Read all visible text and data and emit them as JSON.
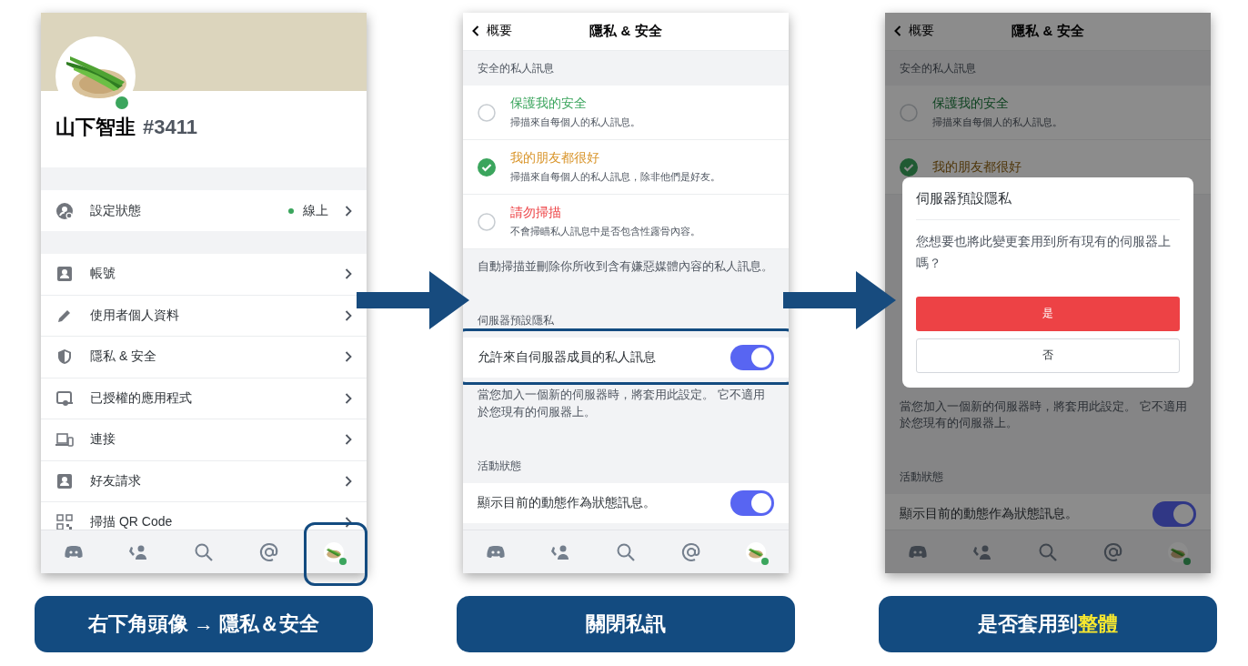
{
  "panels": [
    {
      "kind": "profile",
      "profile": {
        "name": "山下智韭",
        "tag": "#3411"
      },
      "status_row": {
        "label": "設定狀態",
        "value": "線上"
      },
      "menu": [
        {
          "kind": "account",
          "label": "帳號"
        },
        {
          "kind": "pencil",
          "label": "使用者個人資料"
        },
        {
          "kind": "shield",
          "label": "隱私 & 安全"
        },
        {
          "kind": "apps",
          "label": "已授權的應用程式"
        },
        {
          "kind": "devices",
          "label": "連接"
        },
        {
          "kind": "account",
          "label": "好友請求"
        },
        {
          "kind": "qr",
          "label": "掃描 QR Code"
        }
      ],
      "nav": [
        {
          "kind": "home",
          "highlighted": false
        },
        {
          "kind": "friends",
          "highlighted": false
        },
        {
          "kind": "search",
          "highlighted": false
        },
        {
          "kind": "mentions",
          "highlighted": false
        },
        {
          "kind": "profile",
          "highlighted": true
        }
      ],
      "caption": [
        {
          "text": "右下角頭像 → 隱私＆安全",
          "highlight": false
        }
      ]
    },
    {
      "kind": "settings",
      "dimmed": false,
      "header": {
        "back": "概要",
        "title": "隱私 & 安全"
      },
      "blocks": [
        {
          "kind": "label",
          "text": "安全的私人訊息"
        },
        {
          "kind": "radio",
          "title": "保護我的安全",
          "desc": "掃描來自每個人的私人訊息。",
          "color": "#3ba55d",
          "selected": false
        },
        {
          "kind": "radio",
          "title": "我的朋友都很好",
          "desc": "掃描來自每個人的私人訊息，除非他們是好友。",
          "color": "#d9952b",
          "selected": true
        },
        {
          "kind": "radio",
          "title": "請勿掃描",
          "desc": "不會掃瞄私人訊息中是否包含性露骨內容。",
          "color": "#ed4245",
          "selected": false
        },
        {
          "kind": "note",
          "text": "自動掃描並刪除你所收到含有嫌惡媒體內容的私人訊息。"
        },
        {
          "kind": "label",
          "text": "伺服器預設隱私"
        },
        {
          "kind": "toggle",
          "label": "允許來自伺服器成員的私人訊息",
          "on": true,
          "highlighted": true
        },
        {
          "kind": "note",
          "text": "當您加入一個新的伺服器時，將套用此設定。 它不適用於您現有的伺服器上。"
        },
        {
          "kind": "label",
          "text": "活動狀態"
        },
        {
          "kind": "toggle",
          "label": "顯示目前的動態作為狀態訊息。",
          "on": true,
          "highlighted": false
        }
      ],
      "nav": [
        {
          "kind": "home",
          "highlighted": false
        },
        {
          "kind": "friends",
          "highlighted": false
        },
        {
          "kind": "search",
          "highlighted": false
        },
        {
          "kind": "mentions",
          "highlighted": false
        },
        {
          "kind": "profile",
          "highlighted": false
        }
      ],
      "caption": [
        {
          "text": "關閉私訊",
          "highlight": false
        }
      ]
    },
    {
      "kind": "settings",
      "dimmed": true,
      "header": {
        "back": "概要",
        "title": "隱私 & 安全"
      },
      "blocks": [
        {
          "kind": "label",
          "text": "安全的私人訊息"
        },
        {
          "kind": "radio",
          "title": "保護我的安全",
          "desc": "掃描來自每個人的私人訊息。",
          "color": "#0e4220",
          "selected": false
        },
        {
          "kind": "radio",
          "title": "我的朋友都很好",
          "color": "#4f360a",
          "selected": true
        },
        {
          "kind": "dialog",
          "title": "伺服器預設隱私",
          "message": "您想要也將此變更套用到所有現有的伺服器上嗎？",
          "buttons": [
            {
              "label": "是",
              "kind": "danger"
            },
            {
              "label": "否",
              "kind": "secondary"
            }
          ]
        },
        {
          "kind": "note",
          "text": "當您加入一個新的伺服器時，將套用此設定。 它不適用於您現有的伺服器上。"
        },
        {
          "kind": "label",
          "text": "活動狀態"
        },
        {
          "kind": "toggle",
          "label": "顯示目前的動態作為狀態訊息。",
          "on": true,
          "highlighted": false
        }
      ],
      "nav": [
        {
          "kind": "home",
          "highlighted": false
        },
        {
          "kind": "friends",
          "highlighted": false
        },
        {
          "kind": "search",
          "highlighted": false
        },
        {
          "kind": "mentions",
          "highlighted": false
        },
        {
          "kind": "profile",
          "highlighted": false
        }
      ],
      "caption": [
        {
          "text": "是否套用到",
          "highlight": false
        },
        {
          "text": "整體",
          "highlight": true
        }
      ]
    }
  ]
}
